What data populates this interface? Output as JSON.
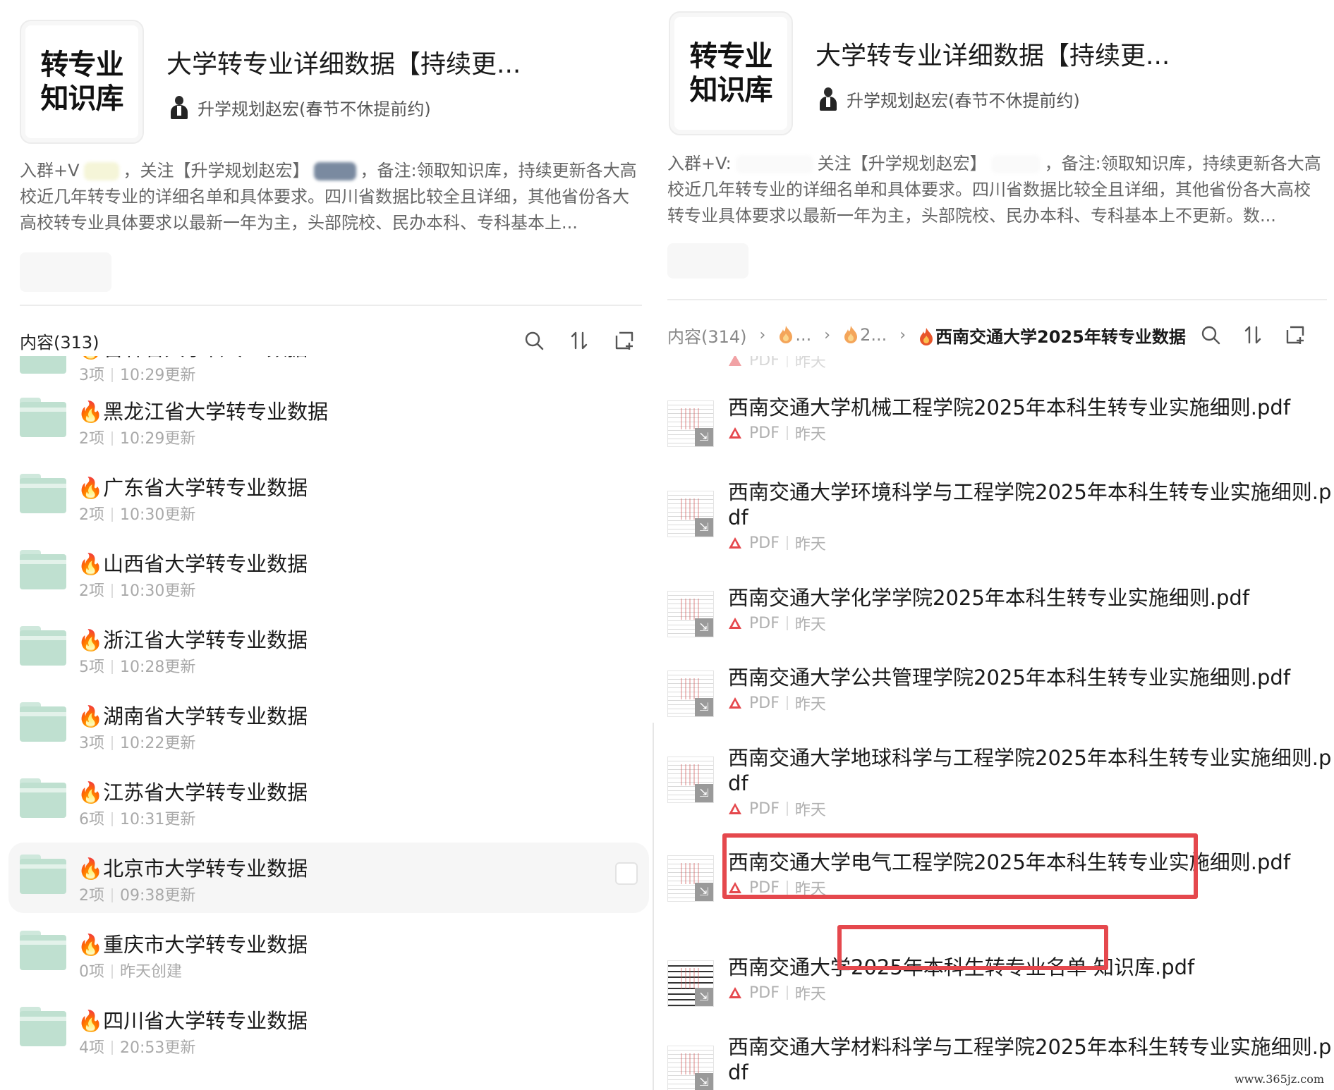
{
  "left": {
    "logo_line1": "转专业",
    "logo_line2": "知识库",
    "title": "大学转专业详细数据【持续更...",
    "author": "升学规划赵宏(春节不休提前约)",
    "desc_part1": "入群+V",
    "desc_part2": "，关注【升学规划赵宏】",
    "desc_part3": "，备注:领取知识库，持续更新各大高校近几年转专业的详细名单和具体要求。四川省数据比较全且详细，其他省份各大高校转专业具体要求以最新一年为主，头部院校、民办本科、专科基本上...",
    "content_title": "内容(313)",
    "partial_folder": {
      "name": "🔥吉林省大学转专业数据",
      "count": "3项",
      "time": "10:29更新"
    },
    "folders": [
      {
        "name": "🔥黑龙江省大学转专业数据",
        "count": "2项",
        "time": "10:29更新"
      },
      {
        "name": "🔥广东省大学转专业数据",
        "count": "2项",
        "time": "10:30更新"
      },
      {
        "name": "🔥山西省大学转专业数据",
        "count": "2项",
        "time": "10:30更新"
      },
      {
        "name": "🔥浙江省大学转专业数据",
        "count": "5项",
        "time": "10:28更新"
      },
      {
        "name": "🔥湖南省大学转专业数据",
        "count": "3项",
        "time": "10:22更新"
      },
      {
        "name": "🔥江苏省大学转专业数据",
        "count": "6项",
        "time": "10:31更新"
      },
      {
        "name": "🔥北京市大学转专业数据",
        "count": "2项",
        "time": "09:38更新"
      },
      {
        "name": "🔥重庆市大学转专业数据",
        "count": "0项",
        "time": "昨天创建"
      },
      {
        "name": "🔥四川省大学转专业数据",
        "count": "4项",
        "time": "20:53更新"
      }
    ]
  },
  "right": {
    "logo_line1": "转专业",
    "logo_line2": "知识库",
    "title": "大学转专业详细数据【持续更...",
    "author": "升学规划赵宏(春节不休提前约)",
    "desc_part1": "入群+V:",
    "desc_part2": "关注【升学规划赵宏】",
    "desc_part3": "，备注:领取知识库，持续更新各大高校近几年转专业的详细名单和具体要求。四川省数据比较全且详细，其他省份各大高校转专业具体要求以最新一年为主，头部院校、民办本科、专科基本上不更新。数...",
    "content_title": "内容(314)",
    "crumb1": "...",
    "crumb2": "2...",
    "crumb_current": "西南交通大学2025年转专业数据",
    "partial_meta": {
      "type": "PDF",
      "time": "昨天"
    },
    "files": [
      {
        "name": "西南交通大学机械工程学院2025年本科生转专业实施细则.pdf",
        "type": "PDF",
        "time": "昨天"
      },
      {
        "name": "西南交通大学环境科学与工程学院2025年本科生转专业实施细则.pdf",
        "type": "PDF",
        "time": "昨天"
      },
      {
        "name": "西南交通大学化学学院2025年本科生转专业实施细则.pdf",
        "type": "PDF",
        "time": "昨天"
      },
      {
        "name": "西南交通大学公共管理学院2025年本科生转专业实施细则.pdf",
        "type": "PDF",
        "time": "昨天"
      },
      {
        "name": "西南交通大学地球科学与工程学院2025年本科生转专业实施细则.pdf",
        "type": "PDF",
        "time": "昨天"
      },
      {
        "name": "西南交通大学电气工程学院2025年本科生转专业实施细则.pdf",
        "type": "PDF",
        "time": "昨天"
      },
      {
        "name": "西南交通大学2025年本科生转专业名单 知识库.pdf",
        "type": "PDF",
        "time": "昨天"
      },
      {
        "name": "西南交通大学材料科学与工程学院2025年本科生转专业实施细则.pdf",
        "type": "PDF",
        "time": "昨天"
      }
    ]
  },
  "watermark": "www.365jz.com",
  "colors": {
    "folder": "#bfe0d0",
    "highlight": "#e5484d",
    "pdf": "#e5484d",
    "meta": "#a9a9a9"
  },
  "icons": [
    "search-icon",
    "sort-icon",
    "add-folder-icon",
    "fire-icon",
    "folder-icon",
    "pdf-icon",
    "chevron-right-icon"
  ]
}
